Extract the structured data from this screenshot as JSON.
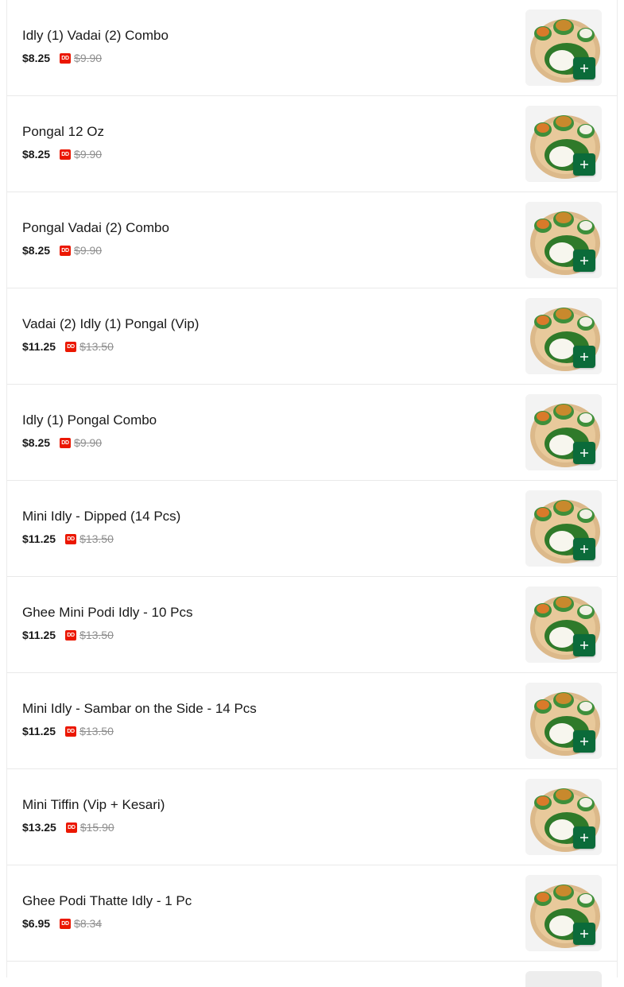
{
  "colors": {
    "add_button": "#0b6b3a",
    "dashpass_badge": "#eb1700",
    "strike_price": "#8f8f8f"
  },
  "badge_text": "DD",
  "add_icon": "plus-icon",
  "items": [
    {
      "name": "Idly (1) Vadai (2) Combo",
      "price": "$8.25",
      "original_price": "$9.90"
    },
    {
      "name": "Pongal 12 Oz",
      "price": "$8.25",
      "original_price": "$9.90"
    },
    {
      "name": "Pongal Vadai (2) Combo",
      "price": "$8.25",
      "original_price": "$9.90"
    },
    {
      "name": "Vadai (2) Idly (1) Pongal (Vip)",
      "price": "$11.25",
      "original_price": "$13.50"
    },
    {
      "name": "Idly (1) Pongal Combo",
      "price": "$8.25",
      "original_price": "$9.90"
    },
    {
      "name": "Mini Idly - Dipped (14 Pcs)",
      "price": "$11.25",
      "original_price": "$13.50"
    },
    {
      "name": "Ghee Mini Podi Idly - 10 Pcs",
      "price": "$11.25",
      "original_price": "$13.50"
    },
    {
      "name": "Mini Idly - Sambar on the Side - 14 Pcs",
      "price": "$11.25",
      "original_price": "$13.50"
    },
    {
      "name": "Mini Tiffin (Vip + Kesari)",
      "price": "$13.25",
      "original_price": "$15.90"
    },
    {
      "name": "Ghee Podi Thatte Idly - 1 Pc",
      "price": "$6.95",
      "original_price": "$8.34"
    }
  ]
}
